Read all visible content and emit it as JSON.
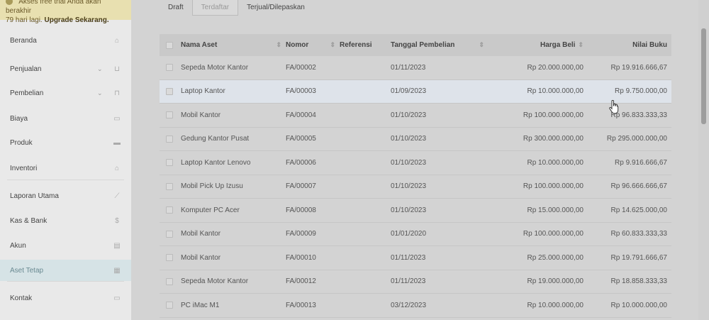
{
  "banner": {
    "text_line1": "Akses free trial Anda akan berakhir",
    "text_line2": "79 hari lagi.",
    "upgrade_link": "Upgrade Sekarang."
  },
  "sidebar": {
    "items": [
      {
        "label": "Beranda",
        "icon": "home-icon",
        "icon_glyph": "⌂",
        "has_chevron": false
      },
      {
        "label": "Penjualan",
        "icon": "basket-icon",
        "icon_glyph": "⊔",
        "has_chevron": true
      },
      {
        "label": "Pembelian",
        "icon": "bag-icon",
        "icon_glyph": "⊓",
        "has_chevron": true
      },
      {
        "label": "Biaya",
        "icon": "card-icon",
        "icon_glyph": "▭",
        "has_chevron": false
      },
      {
        "label": "Produk",
        "icon": "box-icon",
        "icon_glyph": "▬",
        "has_chevron": false
      },
      {
        "label": "Inventori",
        "icon": "warehouse-icon",
        "icon_glyph": "⌂",
        "has_chevron": false
      },
      {
        "label": "Laporan Utama",
        "icon": "chart-icon",
        "icon_glyph": "⟋",
        "has_chevron": false
      },
      {
        "label": "Kas & Bank",
        "icon": "dollar-icon",
        "icon_glyph": "$",
        "has_chevron": false
      },
      {
        "label": "Akun",
        "icon": "ledger-icon",
        "icon_glyph": "▤",
        "has_chevron": false
      },
      {
        "label": "Aset Tetap",
        "icon": "building-icon",
        "icon_glyph": "▦",
        "has_chevron": false
      },
      {
        "label": "Kontak",
        "icon": "contact-card-icon",
        "icon_glyph": "▭",
        "has_chevron": false
      }
    ],
    "chevron_glyph": "⌄"
  },
  "tabs": [
    {
      "label": "Draft"
    },
    {
      "label": "Terdaftar"
    },
    {
      "label": "Terjual/Dilepaskan"
    }
  ],
  "table": {
    "headers": {
      "name": "Nama Aset",
      "number": "Nomor",
      "reference": "Referensi",
      "purchase_date": "Tanggal Pembelian",
      "purchase_price": "Harga Beli",
      "book_value": "Nilai Buku"
    },
    "sort_glyph": "⇕",
    "rows": [
      {
        "name": "Sepeda Motor Kantor",
        "number": "FA/00002",
        "reference": "",
        "date": "01/11/2023",
        "price": "Rp 20.000.000,00",
        "book": "Rp 19.916.666,67"
      },
      {
        "name": "Laptop Kantor",
        "number": "FA/00003",
        "reference": "",
        "date": "01/09/2023",
        "price": "Rp 10.000.000,00",
        "book": "Rp 9.750.000,00"
      },
      {
        "name": "Mobil Kantor",
        "number": "FA/00004",
        "reference": "",
        "date": "01/10/2023",
        "price": "Rp 100.000.000,00",
        "book": "Rp 96.833.333,33"
      },
      {
        "name": "Gedung Kantor Pusat",
        "number": "FA/00005",
        "reference": "",
        "date": "01/10/2023",
        "price": "Rp 300.000.000,00",
        "book": "Rp 295.000.000,00"
      },
      {
        "name": "Laptop Kantor Lenovo",
        "number": "FA/00006",
        "reference": "",
        "date": "01/10/2023",
        "price": "Rp 10.000.000,00",
        "book": "Rp 9.916.666,67"
      },
      {
        "name": "Mobil Pick Up Izusu",
        "number": "FA/00007",
        "reference": "",
        "date": "01/10/2023",
        "price": "Rp 100.000.000,00",
        "book": "Rp 96.666.666,67"
      },
      {
        "name": "Komputer PC Acer",
        "number": "FA/00008",
        "reference": "",
        "date": "01/10/2023",
        "price": "Rp 15.000.000,00",
        "book": "Rp 14.625.000,00"
      },
      {
        "name": "Mobil Kantor",
        "number": "FA/00009",
        "reference": "",
        "date": "01/01/2020",
        "price": "Rp 100.000.000,00",
        "book": "Rp 60.833.333,33"
      },
      {
        "name": "Mobil Kantor",
        "number": "FA/00010",
        "reference": "",
        "date": "01/11/2023",
        "price": "Rp 25.000.000,00",
        "book": "Rp 19.791.666,67"
      },
      {
        "name": "Sepeda Motor Kantor",
        "number": "FA/00012",
        "reference": "",
        "date": "01/11/2023",
        "price": "Rp 19.000.000,00",
        "book": "Rp 18.858.333,33"
      },
      {
        "name": "PC iMac M1",
        "number": "FA/00013",
        "reference": "",
        "date": "03/12/2023",
        "price": "Rp 10.000.000,00",
        "book": "Rp 10.000.000,00"
      }
    ]
  }
}
